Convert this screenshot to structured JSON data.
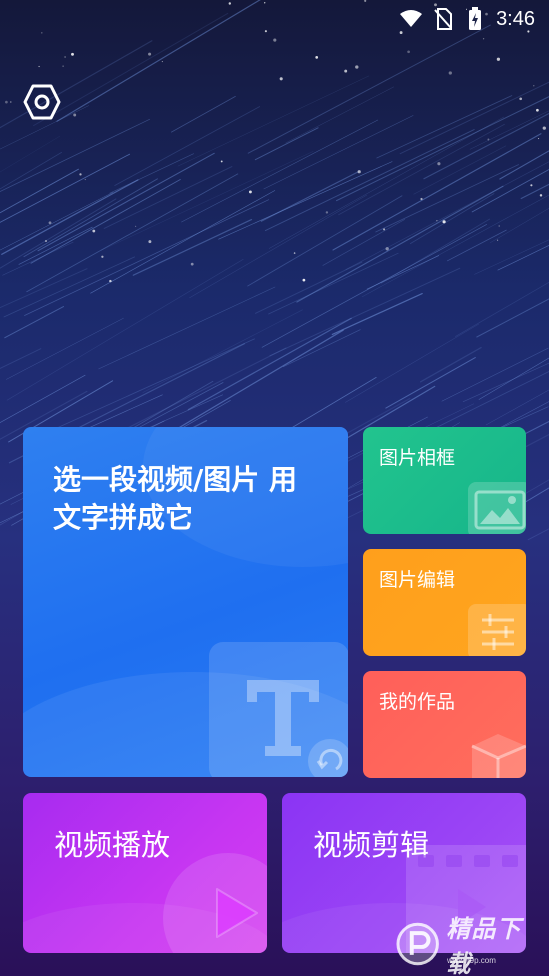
{
  "status_bar": {
    "time": "3:46",
    "icons": [
      "wifi-icon",
      "no-sim-icon",
      "battery-charging-icon"
    ]
  },
  "toolbar": {
    "settings_icon": "settings-hexagon-icon"
  },
  "cards": {
    "main": {
      "label": "选一段视频/图片 用\n文字拼成它",
      "icon": "text-T-icon"
    },
    "photo_frame": {
      "label": "图片相框",
      "icon": "image-icon"
    },
    "photo_edit": {
      "label": "图片编辑",
      "icon": "sliders-icon"
    },
    "my_works": {
      "label": "我的作品",
      "icon": "box-icon"
    },
    "video_play": {
      "label": "视频播放",
      "icon": "play-icon"
    },
    "video_clip": {
      "label": "视频剪辑",
      "icon": "film-play-icon"
    }
  },
  "watermark": {
    "text": "精品下载",
    "sub": "www.jj9p.com"
  },
  "colors": {
    "main_card": "#2a7ef5",
    "photo_frame": "#1ebf8c",
    "photo_edit": "#ffa21d",
    "my_works": "#ff665b",
    "video_play": "#c736f2",
    "video_clip": "#9b45f5"
  }
}
